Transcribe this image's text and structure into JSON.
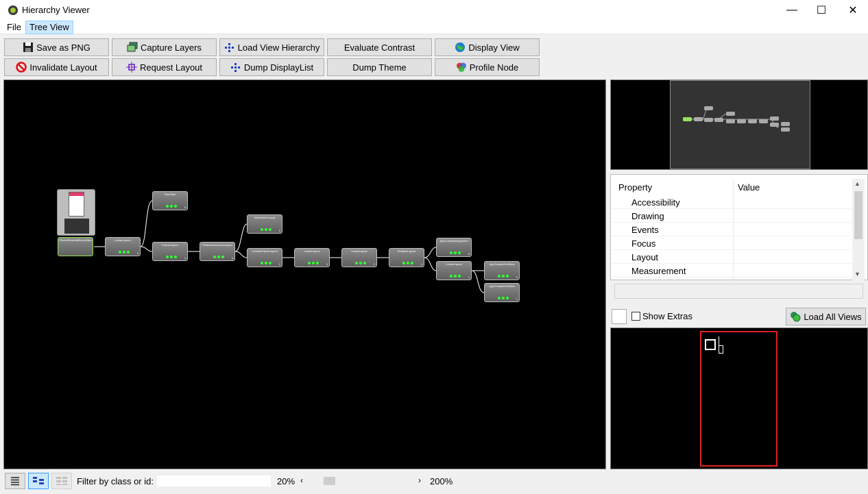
{
  "window": {
    "title": "Hierarchy Viewer",
    "minimize": "—",
    "maximize": "☐",
    "close": "✕"
  },
  "menu": [
    {
      "label": "File"
    },
    {
      "label": "Tree View",
      "active": true
    }
  ],
  "toolbar": {
    "row1": [
      {
        "id": "save-png",
        "label": "Save as PNG",
        "icon": "floppy-disk-icon"
      },
      {
        "id": "capture-layers",
        "label": "Capture Layers",
        "icon": "layers-icon"
      },
      {
        "id": "load-view-hierarchy",
        "label": "Load View Hierarchy",
        "icon": "hierarchy-icon"
      },
      {
        "id": "evaluate-contrast",
        "label": "Evaluate Contrast",
        "icon": ""
      },
      {
        "id": "display-view",
        "label": "Display View",
        "icon": "globe-icon"
      }
    ],
    "row2": [
      {
        "id": "invalidate-layout",
        "label": "Invalidate Layout",
        "icon": "no-entry-icon"
      },
      {
        "id": "request-layout",
        "label": "Request Layout",
        "icon": "crosshair-icon"
      },
      {
        "id": "dump-displaylist",
        "label": "Dump DisplayList",
        "icon": "hierarchy-icon"
      },
      {
        "id": "dump-theme",
        "label": "Dump Theme",
        "icon": ""
      },
      {
        "id": "profile-node",
        "label": "Profile Node",
        "icon": "color-circles-icon"
      }
    ]
  },
  "tree": {
    "nodes": [
      {
        "name": "PhoneWindow$DecorView",
        "id": "",
        "index": "",
        "selected": true
      },
      {
        "name": "LinearLayout",
        "id": "",
        "index": "0"
      },
      {
        "name": "ViewStub",
        "id": "",
        "index": "0"
      },
      {
        "name": "FrameLayout",
        "id": "",
        "index": "1"
      },
      {
        "name": "FitWindowsLinearLayout",
        "id": "",
        "index": "0"
      },
      {
        "name": "ViewStubCompat",
        "id": "",
        "index": "0"
      },
      {
        "name": "ContentFrameLayout",
        "id": "",
        "index": "1"
      },
      {
        "name": "LinearLayout",
        "id": "",
        "index": "0"
      },
      {
        "name": "LinearLayout",
        "id": "",
        "index": "0"
      },
      {
        "name": "RelativeLayout",
        "id": "",
        "index": "0"
      },
      {
        "name": "AppCompatImageView",
        "id": "",
        "index": "0"
      },
      {
        "name": "LinearLayout",
        "id": "",
        "index": "1"
      },
      {
        "name": "AppCompatTextView",
        "id": "",
        "index": "0"
      },
      {
        "name": "AppCompatTextView",
        "id": "",
        "index": "1"
      }
    ]
  },
  "properties": {
    "header_property": "Property",
    "header_value": "Value",
    "rows": [
      "Accessibility",
      "Drawing",
      "Events",
      "Focus",
      "Layout",
      "Measurement"
    ]
  },
  "extras": {
    "show_extras_label": "Show Extras",
    "load_all_views_label": "Load All Views"
  },
  "statusbar": {
    "filter_label": "Filter by class or id:",
    "filter_value": "",
    "zoom_min": "20%",
    "zoom_max": "200%",
    "zoom_level": 0.12
  },
  "colors": {
    "accent": "#cce8ff",
    "selected_node": "#8fe34a",
    "layout_box": "#e02020"
  }
}
